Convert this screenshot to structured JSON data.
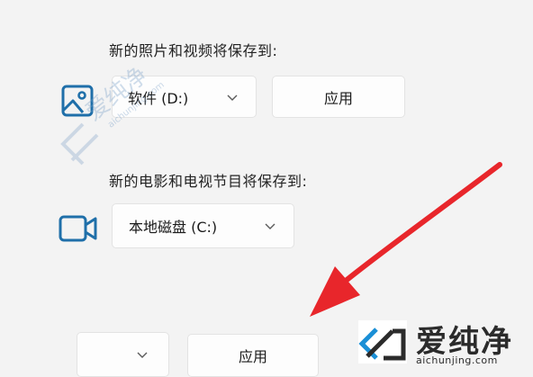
{
  "photos_section": {
    "label": "新的照片和视频将保存到:",
    "icon": "image-icon",
    "drive_dropdown": {
      "selected": "软件 (D:)",
      "chevron": "chevron-down-icon"
    },
    "apply_label": "应用"
  },
  "movies_section": {
    "label": "新的电影和电视节目将保存到:",
    "icon": "video-camera-icon",
    "drive_dropdown": {
      "selected": "本地磁盘 (C:)",
      "chevron": "chevron-down-icon"
    }
  },
  "bottom_row": {
    "drive_dropdown": {
      "selected": "",
      "chevron": "chevron-down-icon"
    },
    "apply_label": "应用"
  },
  "annotation": {
    "arrow_color": "#e8262b",
    "icon": "red-arrow-icon"
  },
  "watermark": {
    "brand": "爱纯净",
    "url": "aichunjing.com",
    "color": "#2b2b2b",
    "accent": "#1a8fd6"
  },
  "colors": {
    "icon_blue": "#1f6fa9",
    "background": "#f3f3f3"
  }
}
